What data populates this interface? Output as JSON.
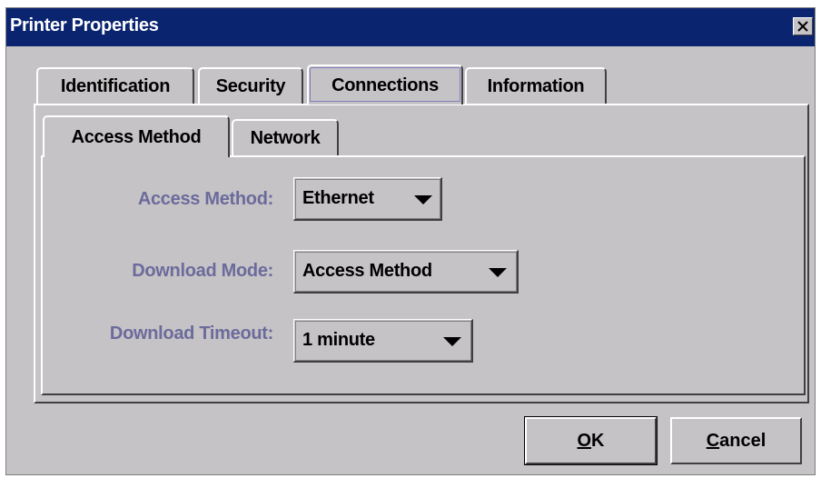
{
  "window": {
    "title": "Printer Properties"
  },
  "tabs": [
    {
      "label": "Identification",
      "selected": false
    },
    {
      "label": "Security",
      "selected": false
    },
    {
      "label": "Connections",
      "selected": true
    },
    {
      "label": "Information",
      "selected": false
    }
  ],
  "subtabs": [
    {
      "label": "Access Method",
      "selected": true
    },
    {
      "label": "Network",
      "selected": false
    }
  ],
  "form": {
    "access_method": {
      "label": "Access Method:",
      "value": "Ethernet"
    },
    "download_mode": {
      "label": "Download Mode:",
      "value": "Access Method"
    },
    "download_timeout": {
      "label": "Download Timeout:",
      "value": "1 minute"
    }
  },
  "buttons": {
    "ok": {
      "mnemonic": "O",
      "rest": "K"
    },
    "cancel": {
      "mnemonic": "C",
      "rest": "ancel"
    }
  },
  "colors": {
    "title_bar": "#0a2470",
    "label_text": "#6b6b9c",
    "face": "#c6c3c6"
  },
  "icons": {
    "close": "close-icon",
    "dropdown": "chevron-down-icon"
  }
}
